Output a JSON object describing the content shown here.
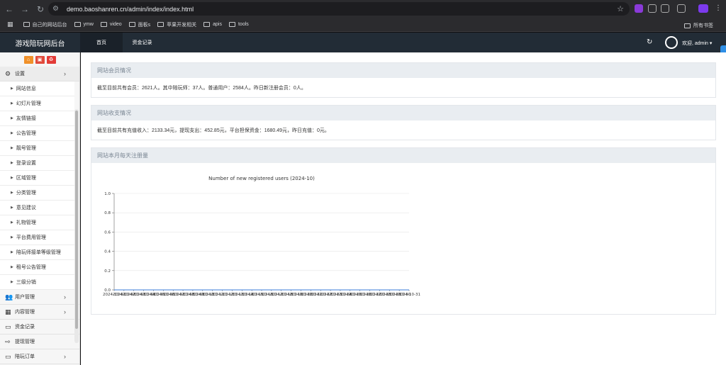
{
  "browser": {
    "url": "demo.baoshanren.cn/admin/index/index.html",
    "bookmarks": [
      "自己的网站后台",
      "ymw",
      "video",
      "面板s",
      "苹果开发相关",
      "apis",
      "tools"
    ],
    "all_bookmarks": "所有书签"
  },
  "header": {
    "brand": "游戏陪玩网后台",
    "tabs": [
      "首页",
      "资金记录"
    ],
    "welcome": "欢迎, admin ▾"
  },
  "sidebar": {
    "settings": "设置",
    "sub_items": [
      "网站信息",
      "幻灯片管理",
      "友情链接",
      "公告管理",
      "靓号管理",
      "登录设置",
      "区域管理",
      "分类管理",
      "意见建议",
      "礼物管理",
      "平台费用管理",
      "陪玩师接单等级管理",
      "租号公告管理",
      "三级分销"
    ],
    "groups": [
      "用户管理",
      "内容管理",
      "资金记录",
      "提现管理",
      "陪玩订单"
    ]
  },
  "main": {
    "members_title": "网站会员情况",
    "members_text": "截至目前共有会员：2621人。其中陪玩师：37人。普通用户：2584人。昨日新注册会员：0人。",
    "finance_title": "网站收支情况",
    "finance_text": "截至目前共有充值收入：2133.34元，提现支出：452.85元，平台担保资金：1680.49元，昨日充值：0元。",
    "chart_title": "网站本月每天注册量"
  },
  "chart_data": {
    "type": "line",
    "title": "Number of new registered users (2024-10)",
    "x": [
      "2024-10-01",
      "2024-10-02",
      "2024-10-03",
      "2024-10-04",
      "2024-10-05",
      "2024-10-06",
      "2024-10-07",
      "2024-10-08",
      "2024-10-09",
      "2024-10-10",
      "2024-10-11",
      "2024-10-12",
      "2024-10-13",
      "2024-10-14",
      "2024-10-15",
      "2024-10-16",
      "2024-10-17",
      "2024-10-18",
      "2024-10-19",
      "2024-10-20",
      "2024-10-21",
      "2024-10-22",
      "2024-10-23",
      "2024-10-24",
      "2024-10-25",
      "2024-10-26",
      "2024-10-27",
      "2024-10-28",
      "2024-10-29",
      "2024-10-30",
      "2024-10-31"
    ],
    "series": [
      {
        "values": [
          0,
          0,
          0,
          0,
          0,
          0,
          0,
          0,
          0,
          0,
          0,
          0,
          0,
          0,
          0,
          0,
          0,
          0,
          0,
          0,
          0,
          0,
          0,
          0,
          0,
          0,
          0,
          0,
          0,
          0,
          0
        ]
      }
    ],
    "yticks": [
      "0.0",
      "0.2",
      "0.4",
      "0.6",
      "0.8",
      "1.0"
    ],
    "ylim": [
      0,
      1
    ],
    "grid": true
  },
  "colors": {
    "header_bg": "#222c36",
    "panel_head": "#e9edf1",
    "btn_orange": "#f0912a",
    "btn_red": "#e14b3c",
    "btn_red2": "#e33b37"
  }
}
